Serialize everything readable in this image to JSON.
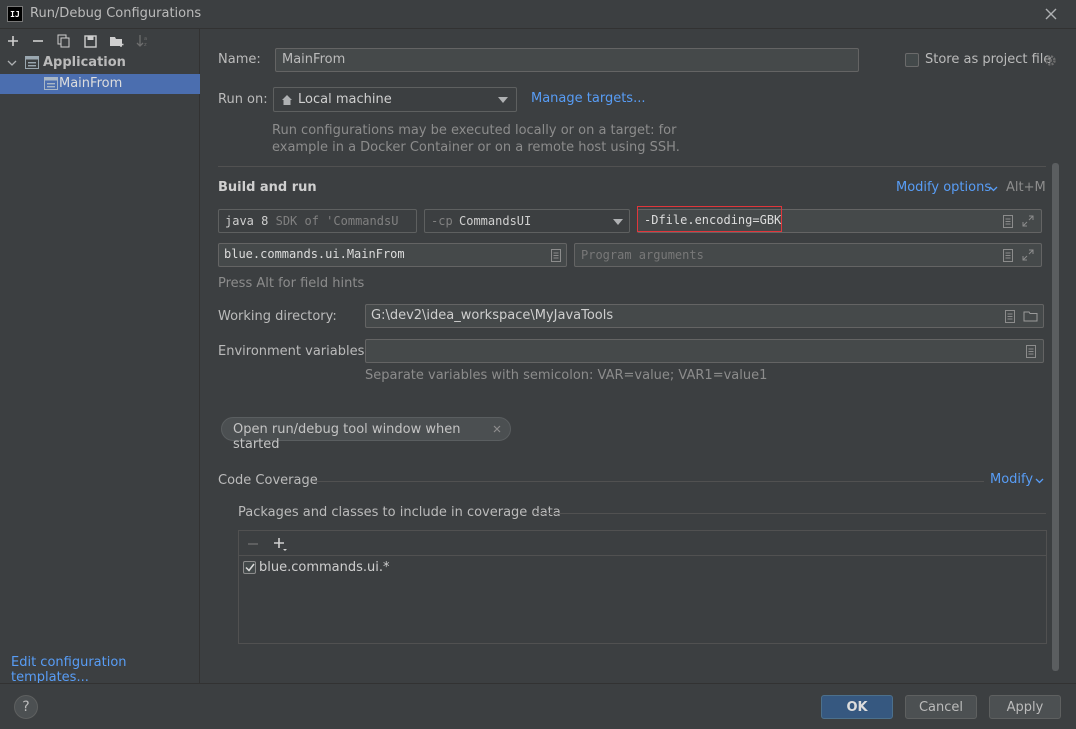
{
  "window": {
    "title": "Run/Debug Configurations",
    "app_icon": "IJ"
  },
  "tree": {
    "root_label": "Application",
    "child_label": "MainFrom"
  },
  "left_footer": {
    "edit_templates": "Edit configuration templates..."
  },
  "form": {
    "name_label": "Name:",
    "name_value": "MainFrom",
    "store_label": "Store as project file",
    "run_on_label": "Run on:",
    "run_on_value": "Local machine",
    "manage_targets": "Manage targets...",
    "run_on_help_line1": "Run configurations may be executed locally or on a target: for",
    "run_on_help_line2": "example in a Docker Container or on a remote host using SSH.",
    "build_run_title": "Build and run",
    "modify_options": "Modify options",
    "modify_shortcut": "Alt+M",
    "sdk_java": "java 8",
    "sdk_detail": "SDK of 'CommandsU",
    "cp_prefix": "-cp",
    "cp_value": "CommandsUI",
    "vm_options": "-Dfile.encoding=GBK",
    "main_class": "blue.commands.ui.MainFrom",
    "program_args_placeholder": "Program arguments",
    "field_hints": "Press Alt for field hints",
    "working_dir_label": "Working directory:",
    "working_dir_value": "G:\\dev2\\idea_workspace\\MyJavaTools",
    "env_label": "Environment variables:",
    "env_value": "",
    "env_help": "Separate variables with semicolon: VAR=value; VAR1=value1",
    "chip_label": "Open run/debug tool window when started",
    "coverage_title": "Code Coverage",
    "coverage_modify": "Modify",
    "coverage_packages_label": "Packages and classes to include in coverage data",
    "coverage_items": [
      "blue.commands.ui.*"
    ]
  },
  "footer": {
    "ok": "OK",
    "cancel": "Cancel",
    "apply": "Apply",
    "help": "?"
  },
  "colors": {
    "background": "#3c3f41",
    "selection": "#4b6eaf",
    "link": "#589df6",
    "highlight_border": "#e0363b"
  }
}
